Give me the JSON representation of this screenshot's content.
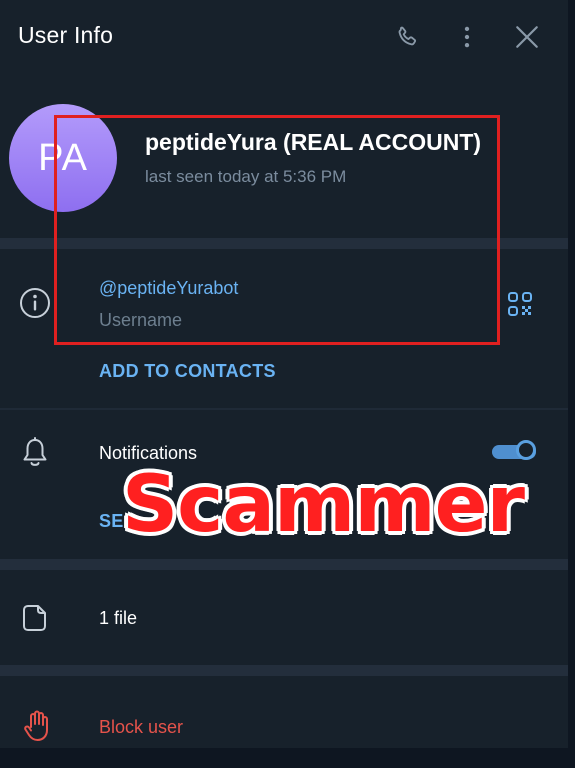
{
  "header": {
    "title": "User Info",
    "icons": [
      "phone-icon",
      "more-vertical-icon",
      "close-icon"
    ]
  },
  "profile": {
    "avatar_initials": "PA",
    "avatar_color": "#9a7ff5",
    "name": "peptideYura (REAL ACCOUNT)",
    "last_seen": "last seen today at 5:36 PM"
  },
  "info": {
    "icon": "info-icon",
    "username": "@peptideYurabot",
    "username_caption": "Username",
    "qr_icon": "qr-code-icon",
    "add_contacts": "ADD TO CONTACTS"
  },
  "notifications": {
    "icon": "bell-icon",
    "label": "Notifications",
    "enabled": true,
    "action_partial": "SE"
  },
  "media": {
    "icon": "file-icon",
    "label": "1 file"
  },
  "block": {
    "icon": "hand-stop-icon",
    "label": "Block user",
    "color": "#e5534b"
  },
  "annotation": {
    "overlay_text": "Scammer",
    "overlay_color": "#ff2020",
    "highlight_color": "#e02020"
  },
  "colors": {
    "background": "#17212b",
    "accent": "#6ab3f3",
    "separator": "#232e3c"
  }
}
